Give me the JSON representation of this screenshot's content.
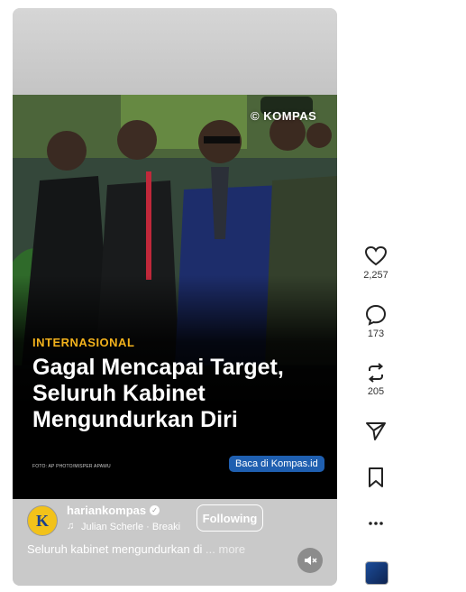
{
  "post": {
    "watermark": "© KOMPAS",
    "category": "INTERNASIONAL",
    "headline_lines": [
      "Gagal Mencapai Target,",
      "Seluruh Kabinet",
      "Mengundurkan Diri"
    ],
    "photo_credit": "FOTO: AP PHOTO/MISPER APAWU",
    "read_button": "Baca di Kompas.id"
  },
  "author": {
    "avatar_letter": "K",
    "username": "hariankompas",
    "music": "Julian Scherle · Breaki",
    "follow_label": "Following"
  },
  "caption": {
    "text": "Seluruh kabinet mengundurkan di",
    "more": "... more"
  },
  "actions": {
    "likes": "2,257",
    "comments": "173",
    "reposts": "205"
  },
  "colors": {
    "category": "#f3b21c",
    "read_button": "#1f5fb0",
    "avatar": "#f2c21a"
  }
}
